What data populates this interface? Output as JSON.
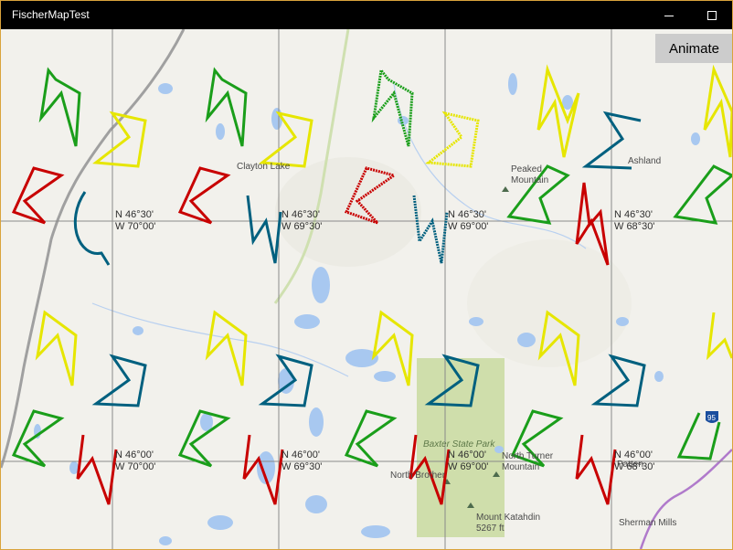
{
  "window": {
    "title": "FischerMapTest"
  },
  "toolbar": {
    "animate_label": "Animate"
  },
  "grid": [
    {
      "lat": "N 46°30'",
      "lon": "W 70°00'"
    },
    {
      "lat": "N 46°30'",
      "lon": "W 69°30'"
    },
    {
      "lat": "N 46°30'",
      "lon": "W 69°00'"
    },
    {
      "lat": "N 46°30'",
      "lon": "W 68°30'"
    },
    {
      "lat": "N 46°00'",
      "lon": "W 70°00'"
    },
    {
      "lat": "N 46°00'",
      "lon": "W 69°30'"
    },
    {
      "lat": "N 46°00'",
      "lon": "W 69°00'"
    },
    {
      "lat": "N 46°00'",
      "lon": "W 68°30'"
    }
  ],
  "places": {
    "clayton_lake": "Clayton Lake",
    "peaked_mountain": "Peaked Mountain",
    "ashland": "Ashland",
    "baxter_state_park": "Baxter State Park",
    "north_brother": "North Brother",
    "north_turner_mountain": "North Turner Mountain",
    "patten": "Patten",
    "mount_katahdin": "Mount Katahdin",
    "katahdin_elevation": "5267 ft",
    "sherman_mills": "Sherman Mills",
    "route_shield": "95"
  },
  "colors": {
    "map_background": "#f2f1ec",
    "water": "#a8c8f0",
    "park": "#c9dba0",
    "gridline": "#8a8a8a",
    "shape_green": "#1a9e1a",
    "shape_yellow": "#e6e600",
    "shape_red": "#c80000",
    "shape_blue": "#00607f"
  }
}
